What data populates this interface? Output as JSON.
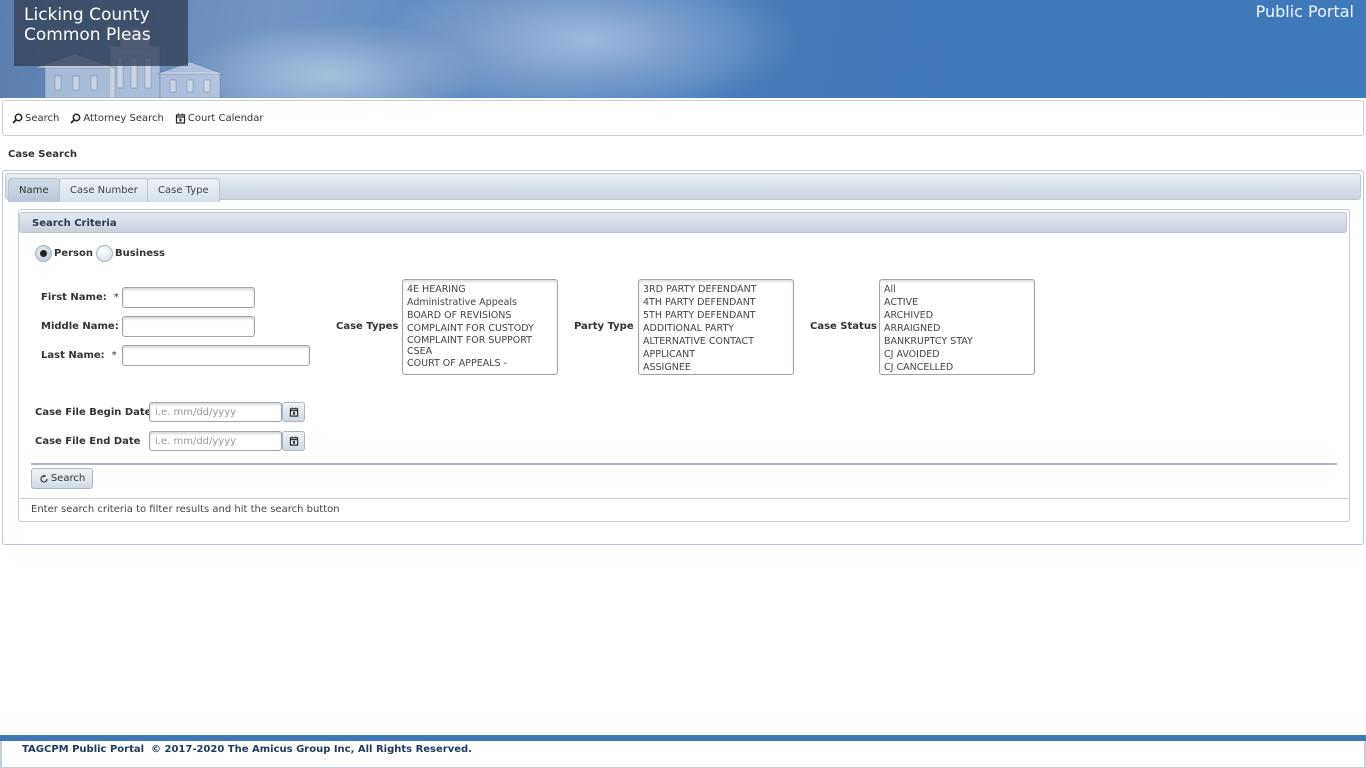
{
  "header": {
    "court_name_line1": "Licking County",
    "court_name_line2": "Common Pleas",
    "portal_title": "Public Portal"
  },
  "nav": {
    "items": [
      {
        "label": "Search",
        "icon": "search-icon"
      },
      {
        "label": "Attorney Search",
        "icon": "search-icon"
      },
      {
        "label": "Court Calendar",
        "icon": "calendar-icon"
      }
    ]
  },
  "page": {
    "title": "Case Search"
  },
  "tabs": [
    {
      "label": "Name",
      "active": true
    },
    {
      "label": "Case Number",
      "active": false
    },
    {
      "label": "Case Type",
      "active": false
    }
  ],
  "criteria": {
    "header": "Search Criteria",
    "radio_options": [
      {
        "label": "Person",
        "checked": true
      },
      {
        "label": "Business",
        "checked": false
      }
    ],
    "first_name_label": "First Name:",
    "middle_name_label": "Middle Name:",
    "last_name_label": "Last Name:",
    "required_marker": "*",
    "first_name_value": "",
    "middle_name_value": "",
    "last_name_value": "",
    "case_types_label": "Case Types",
    "case_types": [
      "4E HEARING",
      "Administrative Appeals",
      "BOARD OF REVISIONS",
      "COMPLAINT FOR CUSTODY",
      "COMPLAINT FOR SUPPORT",
      "CSEA",
      "COURT OF APPEALS -"
    ],
    "party_type_label": "Party Type",
    "party_types": [
      "3RD PARTY DEFENDANT",
      "4TH PARTY DEFENDANT",
      "5TH PARTY DEFENDANT",
      "ADDITIONAL PARTY",
      "ALTERNATIVE CONTACT",
      "APPLICANT",
      "ASSIGNEE"
    ],
    "case_status_label": "Case Status",
    "case_statuses": [
      "All",
      "ACTIVE",
      "ARCHIVED",
      "ARRAIGNED",
      "BANKRUPTCY STAY",
      "CJ AVOIDED",
      "CJ CANCELLED"
    ],
    "begin_date_label": "Case File Begin Date",
    "end_date_label": "Case File End Date",
    "date_placeholder": "i.e. mm/dd/yyyy",
    "search_button": "Search",
    "hint": "Enter search criteria to filter results and hit the search button"
  },
  "footer": {
    "text": "TAGCPM Public Portal  © 2017-2020 The Amicus Group Inc, All Rights Reserved."
  }
}
